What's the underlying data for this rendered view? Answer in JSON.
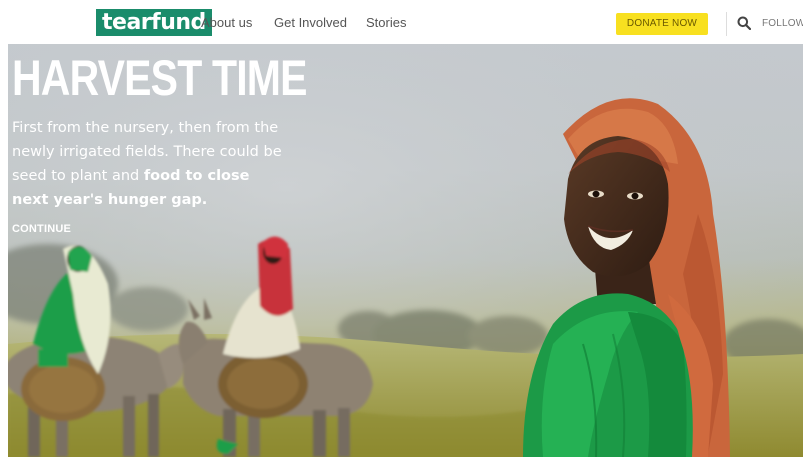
{
  "nav": {
    "logo_text": "tearfund",
    "links": [
      "About us",
      "Get Involved",
      "Stories"
    ],
    "donate_label": "DONATE NOW",
    "search_icon": "search-icon",
    "follow_label": "FOLLOW"
  },
  "hero": {
    "title": "HARVEST TIME",
    "body_plain": "First from the nursery, then from the newly irrigated fields. There could be seed to plant and ",
    "body_bold": "food to close next year's hunger gap.",
    "continue_label": "CONTINUE"
  },
  "colors": {
    "brand_green": "#1a8c6b",
    "donate_yellow": "#f8e020",
    "scarf_green": "#1f9e4a",
    "headscarf_orange": "#d2663a"
  }
}
